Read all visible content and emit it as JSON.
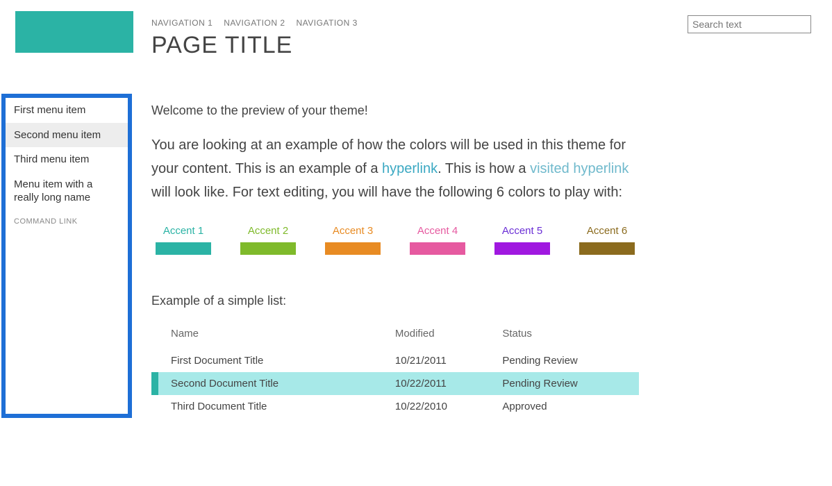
{
  "header": {
    "nav": [
      "NAVIGATION 1",
      "NAVIGATION 2",
      "NAVIGATION 3"
    ],
    "title": "PAGE TITLE"
  },
  "search": {
    "placeholder": "Search text"
  },
  "sidebar": {
    "items": [
      {
        "label": "First menu item",
        "selected": false
      },
      {
        "label": "Second menu item",
        "selected": true
      },
      {
        "label": "Third menu item",
        "selected": false
      },
      {
        "label": "Menu item with a really long name",
        "selected": false
      }
    ],
    "command_link": "COMMAND LINK"
  },
  "content": {
    "welcome": "Welcome to the preview of your theme!",
    "para_a": "You are looking at an example of how the colors will be used in this theme for your content. This is an example of a ",
    "hyperlink_text": "hyperlink",
    "para_b": ". This is how a ",
    "visited_text": "visited hyperlink",
    "para_c": " will look like. For text editing, you will have the following 6 colors to play with:",
    "accents": [
      {
        "label": "Accent 1",
        "color": "#2bb3a5",
        "text_color": "#2bb3a5"
      },
      {
        "label": "Accent 2",
        "color": "#7fba2b",
        "text_color": "#7fba2b"
      },
      {
        "label": "Accent 3",
        "color": "#e88b23",
        "text_color": "#e88b23"
      },
      {
        "label": "Accent 4",
        "color": "#e65aa0",
        "text_color": "#e65aa0"
      },
      {
        "label": "Accent 5",
        "color": "#a018e0",
        "text_color": "#6b2fd6"
      },
      {
        "label": "Accent 6",
        "color": "#8b6b1e",
        "text_color": "#8b6b1e"
      }
    ],
    "list_title": "Example of a simple list:",
    "columns": [
      "Name",
      "Modified",
      "Status"
    ],
    "rows": [
      {
        "name": "First Document Title",
        "modified": "10/21/2011",
        "status": "Pending Review",
        "selected": false
      },
      {
        "name": "Second Document Title",
        "modified": "10/22/2011",
        "status": "Pending Review",
        "selected": true
      },
      {
        "name": "Third Document Title",
        "modified": "10/22/2010",
        "status": "Approved",
        "selected": false
      }
    ]
  }
}
